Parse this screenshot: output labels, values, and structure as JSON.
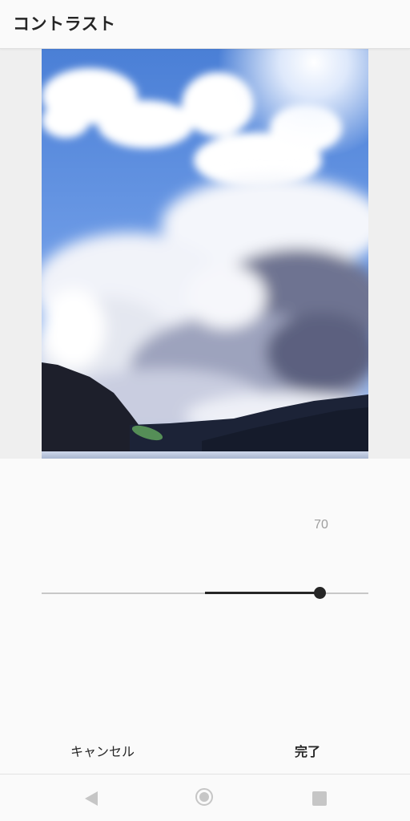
{
  "header": {
    "title": "コントラスト"
  },
  "photo": {
    "subject": "sky-clouds-mountains-lake"
  },
  "adjustment": {
    "value_text": "70",
    "value": 70,
    "min": -100,
    "max": 100
  },
  "actions": {
    "cancel_label": "キャンセル",
    "done_label": "完了"
  },
  "navbar": {
    "back_icon": "back-triangle-icon",
    "home_icon": "home-circle-icon",
    "recents_icon": "recents-square-icon"
  },
  "colors": {
    "accent": "#262626",
    "track": "#c8c8c8",
    "value_text": "#9e9e9e",
    "background": "#fafafa",
    "image_backdrop": "#efefef"
  }
}
